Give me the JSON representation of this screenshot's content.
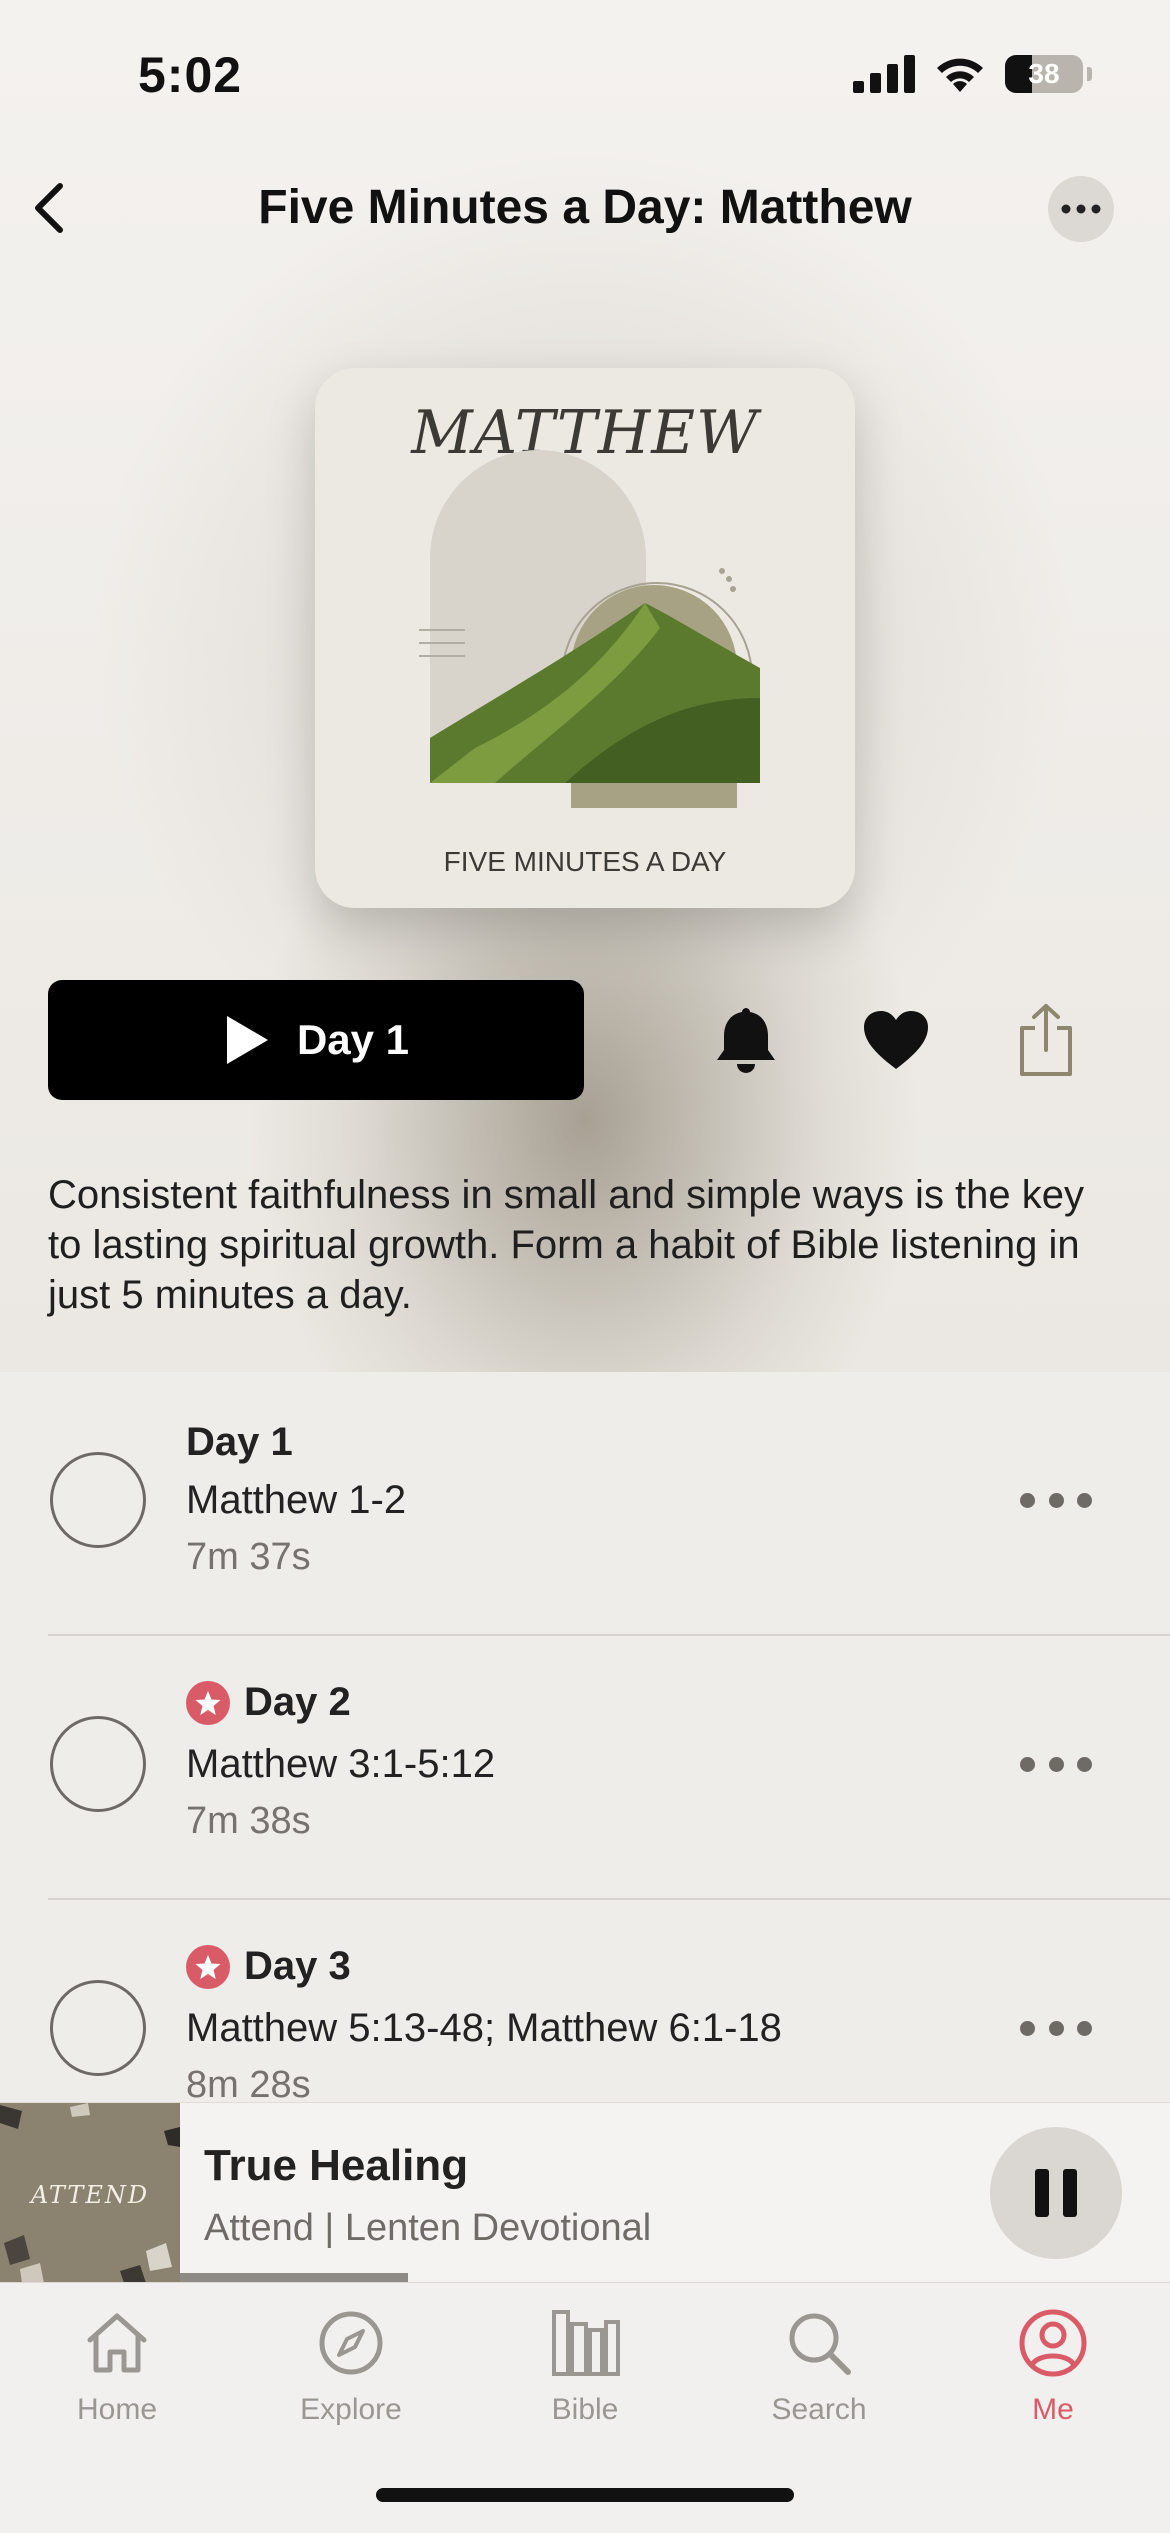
{
  "status_bar": {
    "time": "5:02",
    "battery_level": "38"
  },
  "nav": {
    "title": "Five Minutes a Day: Matthew",
    "back_icon": "chevron-left-icon",
    "more_icon": "ellipsis-icon"
  },
  "cover": {
    "title": "MATTHEW",
    "subtitle": "FIVE MINUTES A DAY"
  },
  "controls": {
    "play_label": "Day 1",
    "bell_icon": "bell-icon",
    "heart_icon": "heart-icon",
    "share_icon": "share-icon"
  },
  "description": "Consistent faithfulness in small and simple ways is the key to lasting spiritual growth. Form a habit of Bible listening in just 5 minutes a day.",
  "days": [
    {
      "title": "Day 1",
      "passage": "Matthew 1-2",
      "duration": "7m 37s",
      "starred": false
    },
    {
      "title": "Day 2",
      "passage": "Matthew 3:1-5:12",
      "duration": "7m 38s",
      "starred": true
    },
    {
      "title": "Day 3",
      "passage": "Matthew 5:13-48; Matthew 6:1-18",
      "duration": "8m 28s",
      "starred": true
    }
  ],
  "mini_player": {
    "art_text": "ATTEND",
    "title": "True Healing",
    "subtitle": "Attend | Lenten Devotional",
    "progress": 0.23
  },
  "tabs": [
    {
      "label": "Home",
      "icon": "home-icon",
      "active": false
    },
    {
      "label": "Explore",
      "icon": "compass-icon",
      "active": false
    },
    {
      "label": "Bible",
      "icon": "bible-books-icon",
      "active": false
    },
    {
      "label": "Search",
      "icon": "search-icon",
      "active": false
    },
    {
      "label": "Me",
      "icon": "profile-icon",
      "active": true
    }
  ],
  "colors": {
    "accent": "#d95b68",
    "primary_button": "#000000",
    "background": "#efedea"
  }
}
